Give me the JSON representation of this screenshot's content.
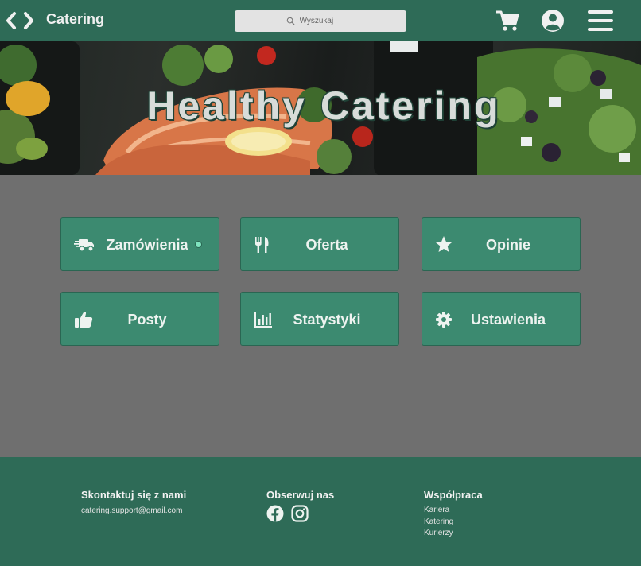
{
  "app": {
    "brand": "Catering"
  },
  "search": {
    "placeholder": "Wyszukaj"
  },
  "hero": {
    "title": "Healthy Catering"
  },
  "tiles": [
    {
      "label": "Zamówienia",
      "icon": "truck-fast-icon",
      "has_dot": true
    },
    {
      "label": "Oferta",
      "icon": "utensils-icon"
    },
    {
      "label": "Opinie",
      "icon": "star-icon"
    },
    {
      "label": "Posty",
      "icon": "thumbs-up-icon"
    },
    {
      "label": "Statystyki",
      "icon": "bar-chart-icon"
    },
    {
      "label": "Ustawienia",
      "icon": "gear-icon"
    }
  ],
  "footer": {
    "contact": {
      "heading": "Skontaktuj się z nami",
      "email": "catering.support@gmail.com"
    },
    "follow": {
      "heading": "Obserwuj nas",
      "icons": [
        "facebook-icon",
        "instagram-icon"
      ]
    },
    "cooperation": {
      "heading": "Współpraca",
      "links": [
        "Kariera",
        "Katering",
        "Kurierzy"
      ]
    }
  },
  "colors": {
    "header": "#2e6b57",
    "tile": "#3c8a70",
    "background": "#6f6f6f",
    "status_dot": "#7fe3bf"
  }
}
